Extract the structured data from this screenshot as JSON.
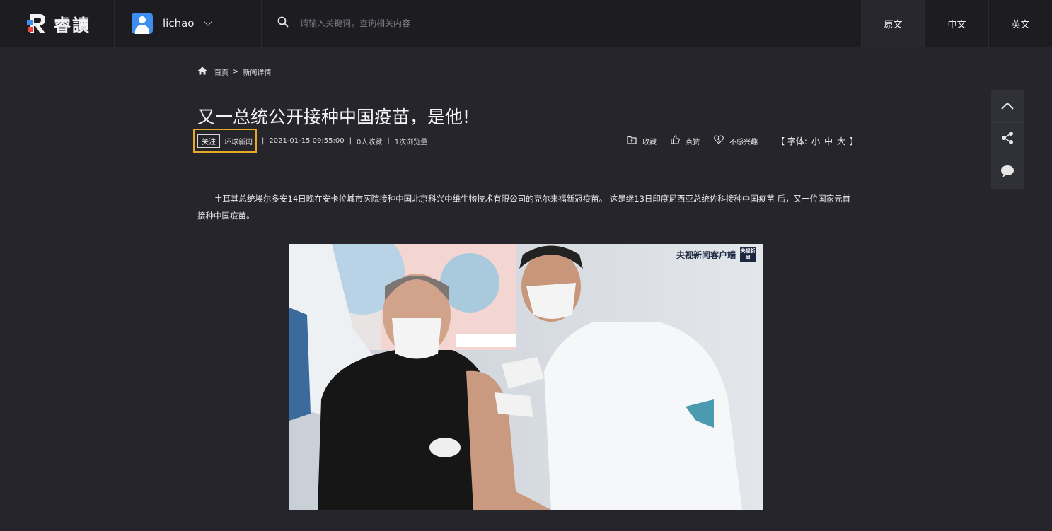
{
  "app": {
    "logo_text": "睿讀",
    "username": "lichao"
  },
  "search": {
    "placeholder": "请输入关键词，查询相关内容"
  },
  "lang_tabs": [
    {
      "label": "原文",
      "active": true
    },
    {
      "label": "中文",
      "active": false
    },
    {
      "label": "英文",
      "active": false
    }
  ],
  "breadcrumb": {
    "home": "首页",
    "separator": ">",
    "current": "新闻详情"
  },
  "article": {
    "title": "又一总统公开接种中国疫苗，是他!",
    "follow_label": "关注",
    "source": "环球新闻",
    "date": "2021-01-15 09:55:00",
    "favorites": "0人收藏",
    "views": "1次浏览量",
    "paragraph": "土耳其总统埃尔多安14日晚在安卡拉城市医院接种中国北京科兴中维生物技术有限公司的克尔来福新冠疫苗。 这是继13日印度尼西亚总统佐科接种中国疫苗 后，又一位国家元首接种中国疫苗。"
  },
  "actions": {
    "collect": "收藏",
    "like": "点赞",
    "dislike": "不感兴趣",
    "font_prefix": "【 字体:",
    "font_small": "小",
    "font_medium": "中",
    "font_large": "大",
    "font_suffix": "】"
  },
  "photo": {
    "watermark_text": "央视新闻客户端",
    "watermark_badge": "央视新闻"
  },
  "colors": {
    "background": "#25252b",
    "topbar": "#1c1c21",
    "highlight_border": "#e5a924",
    "avatar": "#3d8ef0",
    "logo_red": "#e8453c",
    "logo_blue": "#3d8ef0"
  }
}
